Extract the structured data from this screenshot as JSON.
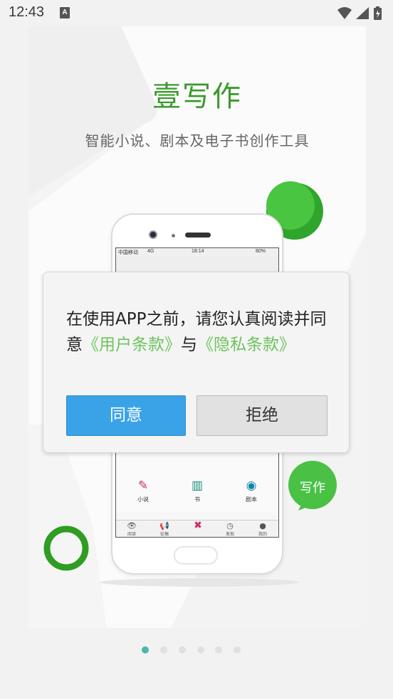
{
  "status_bar": {
    "time": "12:43",
    "notification_icon": "A"
  },
  "brand": {
    "title": "壹写作",
    "subtitle": "智能小说、剧本及电子书创作工具",
    "title_color": "#3b9a2c"
  },
  "phone_screen": {
    "status_carrier": "中国移动",
    "status_network": "4G",
    "status_time": "18:14",
    "status_battery": "80%",
    "categories": [
      {
        "label": "小说",
        "icon": "brush-icon"
      },
      {
        "label": "书",
        "icon": "books-icon"
      },
      {
        "label": "剧本",
        "icon": "film-reel-icon"
      }
    ],
    "tabs": [
      {
        "label": "阅读",
        "icon": "eye-icon"
      },
      {
        "label": "征稿",
        "icon": "megaphone-icon"
      },
      {
        "label": "",
        "icon": "close-circle-icon"
      },
      {
        "label": "发现",
        "icon": "clock-icon"
      },
      {
        "label": "我的",
        "icon": "user-icon"
      }
    ]
  },
  "bubble": {
    "label": "写作"
  },
  "dialog": {
    "message_prefix": "在使用APP之前，请您认真阅读并同意",
    "terms_link": "《用户条款》",
    "connector": "与",
    "privacy_link": "《隐私条款》",
    "agree_label": "同意",
    "reject_label": "拒绝",
    "link_color": "#6ec35d",
    "agree_color": "#3aa3e8"
  },
  "pager": {
    "count": 6,
    "active_index": 0,
    "active_color": "#4db6ac"
  }
}
